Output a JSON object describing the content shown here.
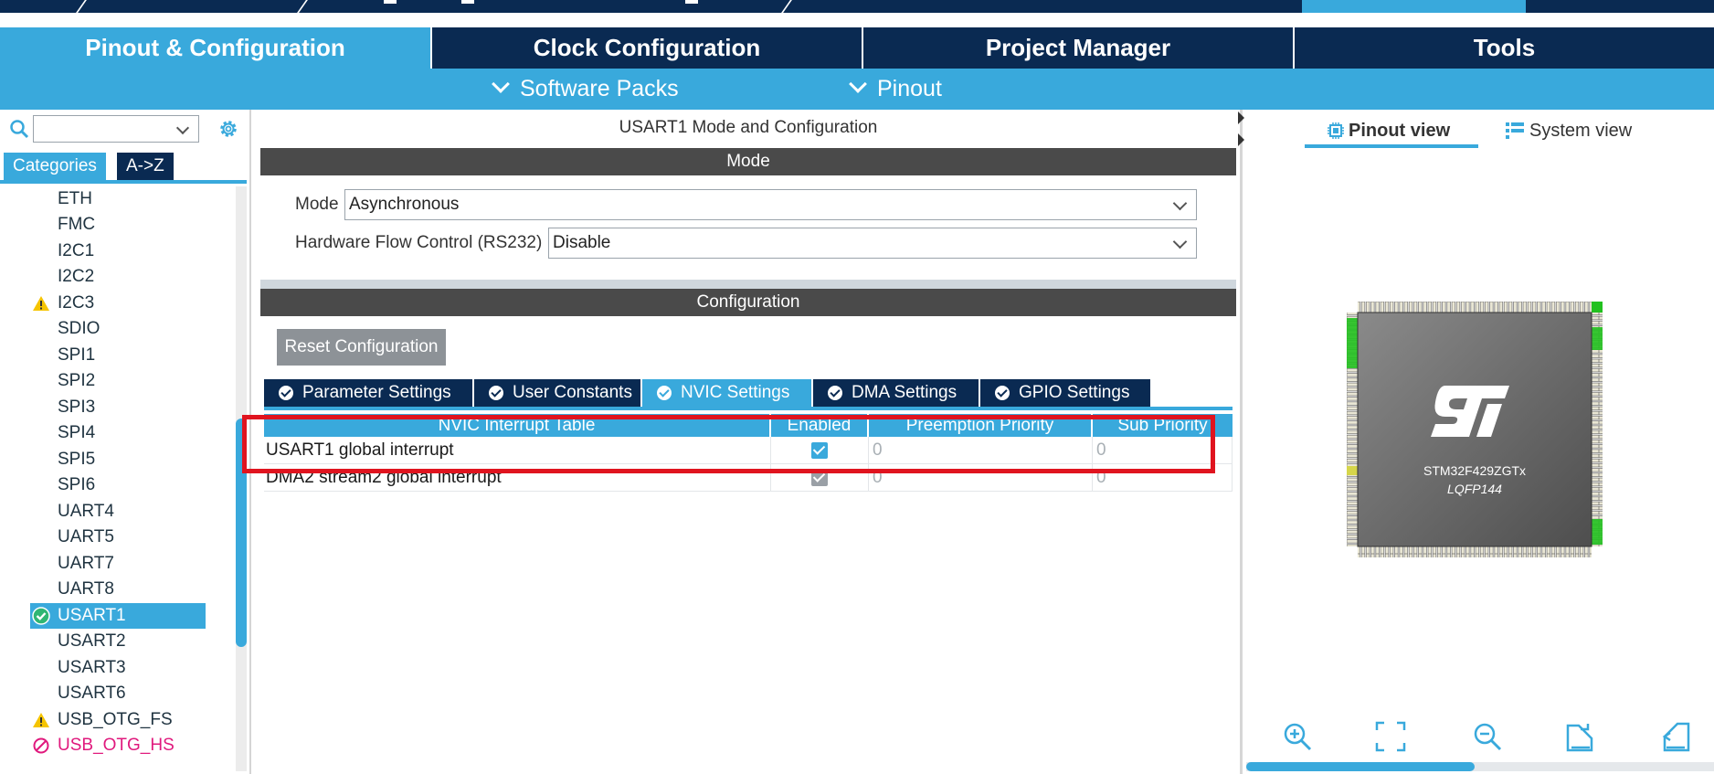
{
  "main_tabs": [
    {
      "label": "Pinout & Configuration",
      "active": true
    },
    {
      "label": "Clock Configuration",
      "active": false
    },
    {
      "label": "Project Manager",
      "active": false
    },
    {
      "label": "Tools",
      "active": false
    }
  ],
  "sub_menus": [
    {
      "label": "Software Packs"
    },
    {
      "label": "Pinout"
    }
  ],
  "left_panel": {
    "search_value": "",
    "categories_label": "Categories",
    "az_label": "A->Z",
    "peripherals": [
      {
        "label": "ETH",
        "status": "none"
      },
      {
        "label": "FMC",
        "status": "none"
      },
      {
        "label": "I2C1",
        "status": "none"
      },
      {
        "label": "I2C2",
        "status": "none"
      },
      {
        "label": "I2C3",
        "status": "warning"
      },
      {
        "label": "SDIO",
        "status": "none"
      },
      {
        "label": "SPI1",
        "status": "none"
      },
      {
        "label": "SPI2",
        "status": "none"
      },
      {
        "label": "SPI3",
        "status": "none"
      },
      {
        "label": "SPI4",
        "status": "none"
      },
      {
        "label": "SPI5",
        "status": "none"
      },
      {
        "label": "SPI6",
        "status": "none"
      },
      {
        "label": "UART4",
        "status": "none"
      },
      {
        "label": "UART5",
        "status": "none"
      },
      {
        "label": "UART7",
        "status": "none"
      },
      {
        "label": "UART8",
        "status": "none"
      },
      {
        "label": "USART1",
        "status": "ok",
        "selected": true
      },
      {
        "label": "USART2",
        "status": "none"
      },
      {
        "label": "USART3",
        "status": "none"
      },
      {
        "label": "USART6",
        "status": "none"
      },
      {
        "label": "USB_OTG_FS",
        "status": "warning"
      },
      {
        "label": "USB_OTG_HS",
        "status": "blocked"
      }
    ]
  },
  "middle_panel": {
    "title": "USART1 Mode and Configuration",
    "mode_header": "Mode",
    "mode_label": "Mode",
    "mode_value": "Asynchronous",
    "flow_label": "Hardware Flow Control (RS232)",
    "flow_value": "Disable",
    "config_header": "Configuration",
    "reset_button": "Reset Configuration",
    "config_tabs": [
      {
        "label": "Parameter Settings",
        "active": false
      },
      {
        "label": "User Constants",
        "active": false
      },
      {
        "label": "NVIC Settings",
        "active": true
      },
      {
        "label": "DMA Settings",
        "active": false
      },
      {
        "label": "GPIO Settings",
        "active": false
      }
    ],
    "nvic_table": {
      "columns": [
        "NVIC Interrupt Table",
        "Enabled",
        "Preemption Priority",
        "Sub Priority"
      ],
      "rows": [
        {
          "name": "USART1 global interrupt",
          "enabled": true,
          "preemption": "0",
          "sub": "0",
          "editable": true
        },
        {
          "name": "DMA2 stream2 global interrupt",
          "enabled": true,
          "preemption": "0",
          "sub": "0",
          "editable": false
        }
      ]
    }
  },
  "right_panel": {
    "pinout_view": "Pinout view",
    "system_view": "System view",
    "chip_part": "STM32F429ZGTx",
    "chip_package": "LQFP144",
    "zoom_controls": [
      "zoom-in-icon",
      "fit-screen-icon",
      "zoom-out-icon",
      "rotate-right-icon",
      "rotate-left-icon"
    ]
  },
  "colors": {
    "navy": "#0a2a52",
    "accent": "#39a9dc",
    "warning": "#f5c400",
    "ok": "#2fb673",
    "blocked": "#e0197d",
    "highlight": "#e0141f"
  }
}
